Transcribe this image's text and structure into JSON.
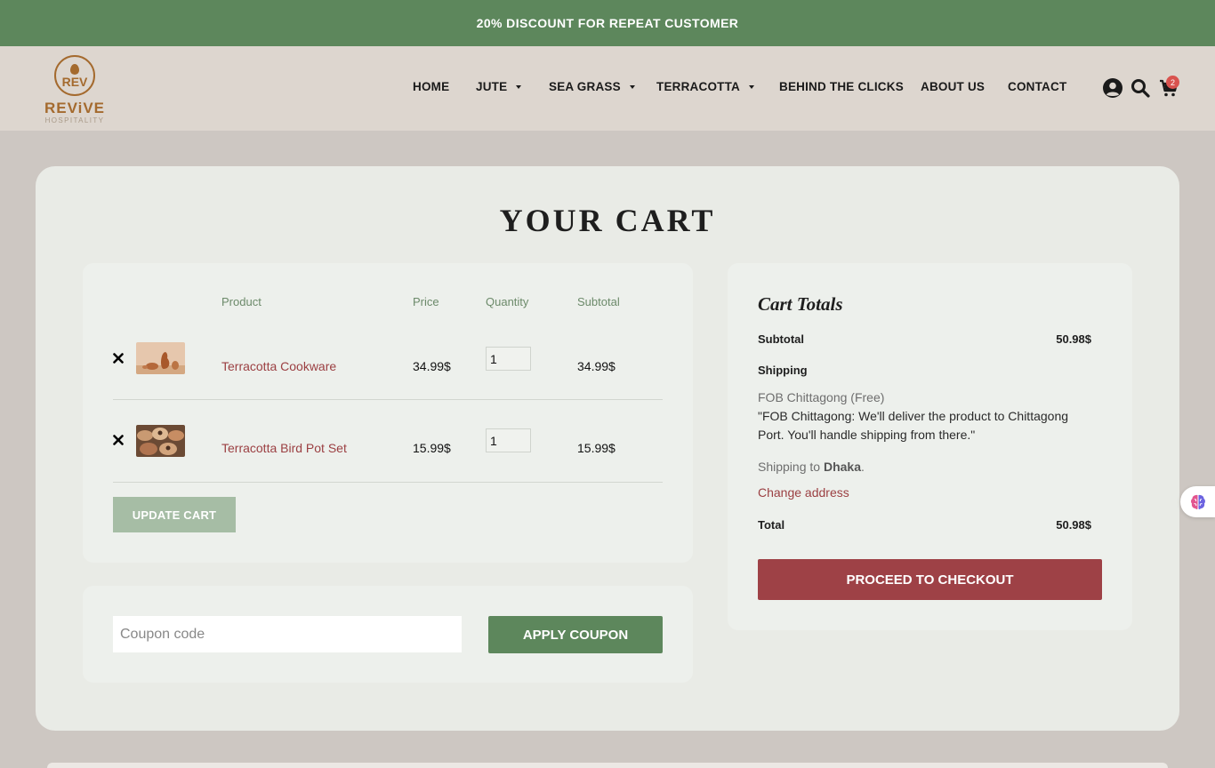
{
  "promo": {
    "text": "20% DISCOUNT FOR REPEAT CUSTOMER"
  },
  "header": {
    "logo_mark": "REV",
    "logo_name": "REViVE",
    "logo_sub": "HOSPITALITY",
    "nav": [
      {
        "label": "HOME",
        "dropdown": false
      },
      {
        "label": "JUTE",
        "dropdown": true
      },
      {
        "label": "SEA GRASS",
        "dropdown": true
      },
      {
        "label": "TERRACOTTA",
        "dropdown": true
      },
      {
        "label": "BEHIND THE CLICKS",
        "dropdown": false
      },
      {
        "label": "ABOUT US",
        "dropdown": false
      },
      {
        "label": "CONTACT",
        "dropdown": false
      }
    ],
    "icons": [
      "user-icon",
      "search-icon",
      "cart-icon"
    ],
    "cart_count": "2"
  },
  "cart": {
    "title": "YOUR CART",
    "columns": {
      "product": "Product",
      "price": "Price",
      "quantity": "Quantity",
      "subtotal": "Subtotal"
    },
    "items": [
      {
        "name": "Terracotta Cookware",
        "price": "34.99$",
        "quantity": "1",
        "subtotal": "34.99$"
      },
      {
        "name": "Terracotta Bird Pot Set",
        "price": "15.99$",
        "quantity": "1",
        "subtotal": "15.99$"
      }
    ],
    "update_label": "UPDATE CART",
    "coupon_placeholder": "Coupon code",
    "apply_label": "APPLY COUPON"
  },
  "totals": {
    "title": "Cart Totals",
    "subtotal_label": "Subtotal",
    "subtotal_value": "50.98$",
    "shipping_label": "Shipping",
    "shipping_method": "FOB Chittagong (Free)",
    "shipping_note": "\"FOB Chittagong: We'll deliver the product to Chittagong Port. You'll handle shipping from there.\"",
    "shipping_to_prefix": "Shipping to ",
    "shipping_to_city": "Dhaka",
    "shipping_to_suffix": ".",
    "change_address": "Change address",
    "total_label": "Total",
    "total_value": "50.98$",
    "checkout_label": "PROCEED TO CHECKOUT"
  },
  "colors": {
    "brand_green": "#5d875c",
    "accent_red": "#9e4146",
    "logo_brown": "#a46a2e"
  }
}
